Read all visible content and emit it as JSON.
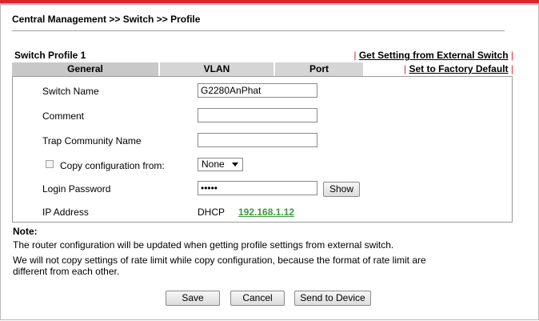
{
  "breadcrumb": "Central Management >> Switch >> Profile",
  "profile_title": "Switch Profile 1",
  "links": {
    "pipe": "|",
    "get_setting": "Get Setting from External Switch",
    "factory_default": "Set to Factory Default"
  },
  "tabs": [
    {
      "label": "General",
      "active": true
    },
    {
      "label": "VLAN",
      "active": false
    },
    {
      "label": "Port",
      "active": false
    }
  ],
  "form": {
    "switch_name_label": "Switch Name",
    "switch_name_value": "G2280AnPhat",
    "comment_label": "Comment",
    "comment_value": "",
    "trap_label": "Trap Community Name",
    "trap_value": "",
    "copy_label": "Copy configuration from:",
    "copy_checked": false,
    "copy_value": "None",
    "login_label": "Login Password",
    "login_value": "•••••",
    "show_button": "Show",
    "ip_label": "IP Address",
    "ip_mode": "DHCP",
    "ip_value": "192.168.1.12"
  },
  "note": {
    "title": "Note:",
    "lines": [
      "The router configuration will be updated when getting profile settings from external switch.",
      "We will not copy settings of rate limit while copy configuration, because the format of rate limit are",
      "different from each other."
    ]
  },
  "buttons": {
    "save": "Save",
    "cancel": "Cancel",
    "send": "Send to Device"
  },
  "colors": {
    "accent_red": "#d7262c",
    "ip_green": "#3a9a3a",
    "tab_gray": "#d5d5d5"
  }
}
